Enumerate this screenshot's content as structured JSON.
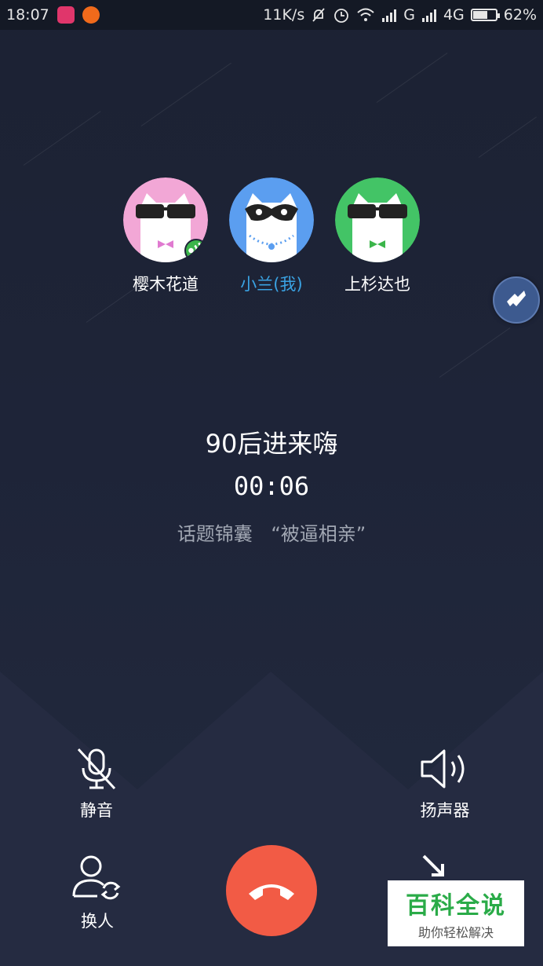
{
  "status_bar": {
    "time": "18:07",
    "network_speed": "11K/s",
    "signal_label_g": "G",
    "signal_label_4g": "4G",
    "battery": "62%",
    "battery_level": 0.62,
    "icons": [
      "app-icon",
      "app-icon",
      "mute-bell-icon",
      "alarm-icon",
      "wifi-icon",
      "signal-icon",
      "signal-icon",
      "battery-icon"
    ]
  },
  "participants": [
    {
      "name": "樱木花道",
      "avatar_color": "#f2a7d6",
      "accessory": "sunglasses",
      "bow_color": "#e07ad0",
      "speaking": true
    },
    {
      "name": "小兰(我)",
      "avatar_color": "#5b9ef0",
      "accessory": "mask",
      "is_me": true
    },
    {
      "name": "上杉达也",
      "avatar_color": "#43c466",
      "accessory": "sunglasses",
      "bow_color": "#3bb54a"
    }
  ],
  "room": {
    "title": "90后进来嗨",
    "timer": "00:06",
    "topic_label": "话题锦囊",
    "topic_value": "“被逼相亲”"
  },
  "controls": {
    "mute_label": "静音",
    "speaker_label": "扬声器",
    "switch_label": "换人"
  },
  "colors": {
    "accent_me": "#3aa3e3",
    "hangup": "#f25b45",
    "speaking_badge": "#3bb54a"
  },
  "watermark": {
    "title": "百科全说",
    "subtitle": "助你轻松解决"
  }
}
